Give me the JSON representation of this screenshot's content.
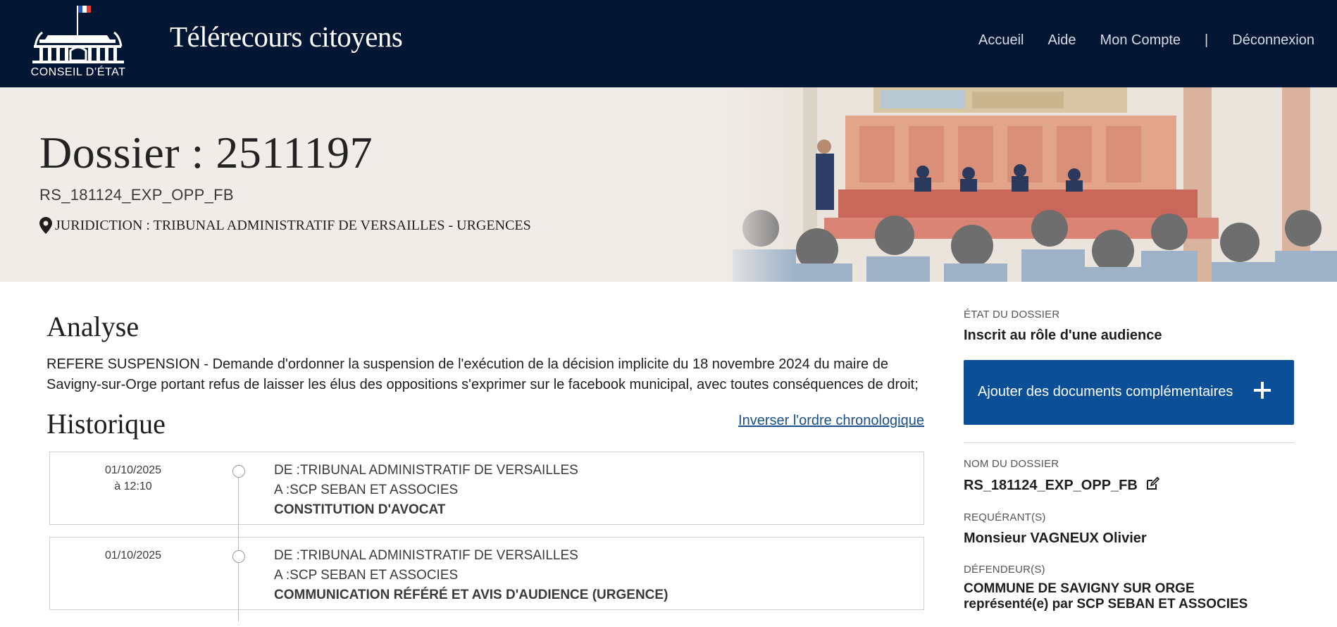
{
  "header": {
    "logo_text": "CONSEIL D’ÉTAT",
    "site_title": "Télérecours citoyens",
    "nav": {
      "home": "Accueil",
      "help": "Aide",
      "account": "Mon Compte",
      "separator": "|",
      "logout": "Déconnexion"
    }
  },
  "banner": {
    "title": "Dossier : 2511197",
    "subtitle": "RS_181124_EXP_OPP_FB",
    "juridiction": "JURIDICTION : TRIBUNAL ADMINISTRATIF DE VERSAILLES - URGENCES"
  },
  "analyse": {
    "title": "Analyse",
    "text": "REFERE SUSPENSION - Demande d'ordonner la suspension de l'exécution de la décision implicite du 18 novembre 2024 du maire de Savigny-sur-Orge portant refus de laisser les élus des oppositions s'exprimer sur le facebook municipal, avec toutes conséquences de droit;"
  },
  "historique": {
    "title": "Historique",
    "invert_link": "Inverser l'ordre chronologique",
    "items": [
      {
        "date": "01/10/2025",
        "time": "à 12:10",
        "from": "DE :TRIBUNAL ADMINISTRATIF DE VERSAILLES",
        "to": "A :SCP SEBAN ET ASSOCIES",
        "type": "CONSTITUTION D'AVOCAT"
      },
      {
        "date": "01/10/2025",
        "time": "",
        "from": "DE :TRIBUNAL ADMINISTRATIF DE VERSAILLES",
        "to": "A :SCP SEBAN ET ASSOCIES",
        "type": "COMMUNICATION RÉFÉRÉ ET AVIS D'AUDIENCE (URGENCE)"
      }
    ]
  },
  "sidebar": {
    "etat_label": "ÉTAT DU DOSSIER",
    "etat_value": "Inscrit au rôle d'une audience",
    "add_button": "Ajouter des documents complémentaires",
    "nom_label": "NOM DU DOSSIER",
    "nom_value": "RS_181124_EXP_OPP_FB",
    "requerant_label": "REQUÉRANT(S)",
    "requerant_value": "Monsieur VAGNEUX Olivier",
    "defendeur_label": "DÉFENDEUR(S)",
    "defendeur_line1": "COMMUNE DE SAVIGNY SUR ORGE",
    "defendeur_line2": "représenté(e) par SCP SEBAN ET ASSOCIES"
  },
  "colors": {
    "header_bg": "#031633",
    "banner_bg": "#f0ece8",
    "button_bg": "#0c4f99",
    "link": "#1b4f8a"
  },
  "icons": [
    "conseil-etat-logo",
    "location-pin-icon",
    "plus-icon",
    "edit-icon",
    "timeline-dot-icon"
  ]
}
